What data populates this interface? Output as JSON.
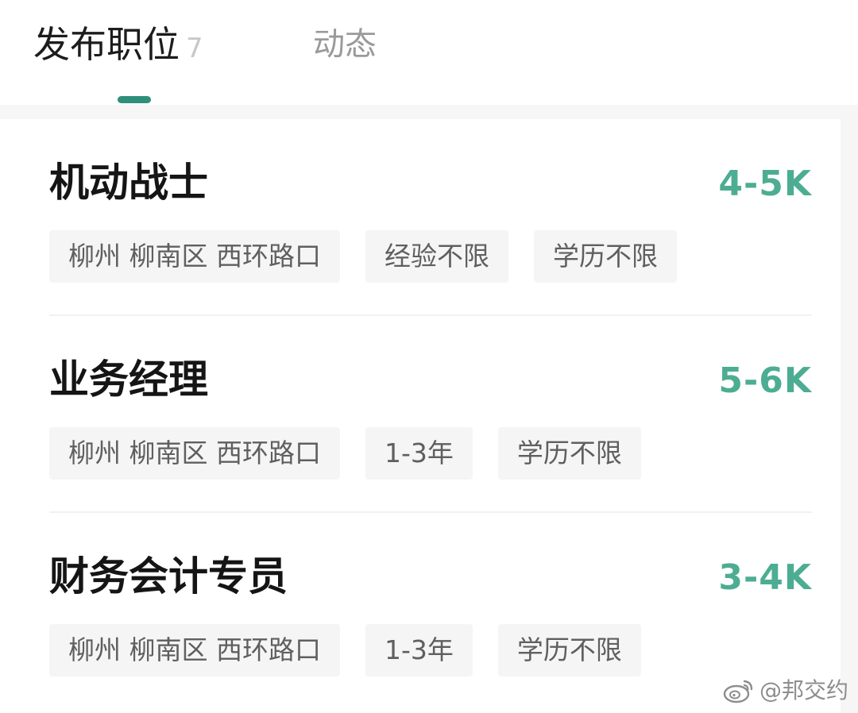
{
  "tabs": {
    "active": {
      "label": "发布职位",
      "count": "7"
    },
    "inactive": {
      "label": "动态"
    }
  },
  "jobs": [
    {
      "title": "机动战士",
      "salary": "4-5K",
      "tags": [
        "柳州 柳南区 西环路口",
        "经验不限",
        "学历不限"
      ]
    },
    {
      "title": "业务经理",
      "salary": "5-6K",
      "tags": [
        "柳州 柳南区 西环路口",
        "1-3年",
        "学历不限"
      ]
    },
    {
      "title": "财务会计专员",
      "salary": "3-4K",
      "tags": [
        "柳州 柳南区 西环路口",
        "1-3年",
        "学历不限"
      ]
    }
  ],
  "watermark": {
    "icon": "weibo-icon",
    "text": "@邦交约"
  },
  "colors": {
    "accent": "#2f8f7a",
    "salary": "#4cad92",
    "tag_bg": "#f5f5f5"
  }
}
